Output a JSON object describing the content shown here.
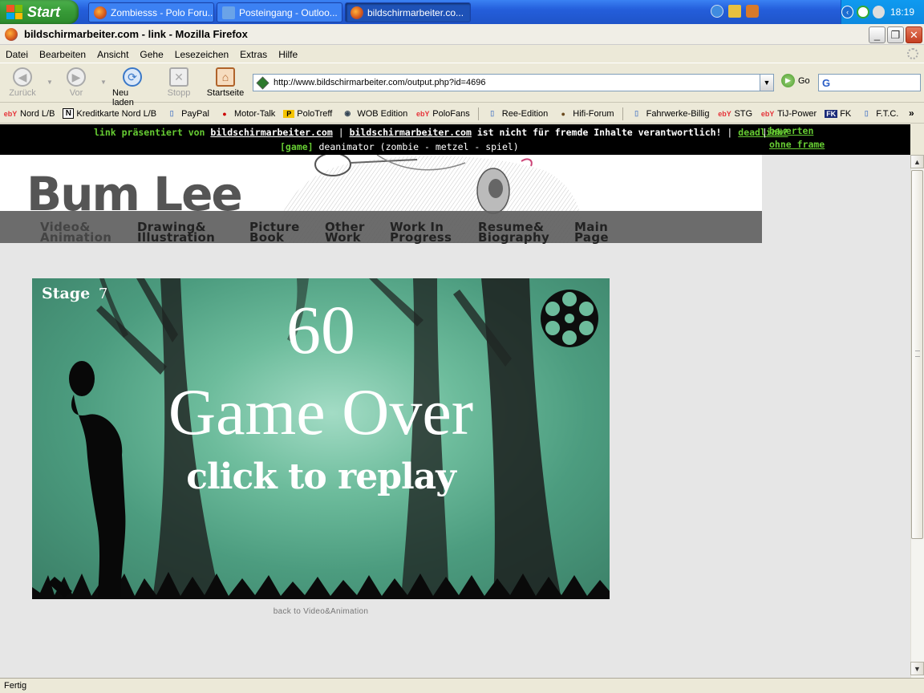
{
  "taskbar": {
    "start_label": "Start",
    "tasks": [
      {
        "label": "Zombiesss - Polo Foru..."
      },
      {
        "label": "Posteingang - Outloo..."
      },
      {
        "label": "bildschirmarbeiter.co..."
      }
    ],
    "clock": "18:19"
  },
  "window": {
    "title": "bildschirmarbeiter.com - link - Mozilla Firefox"
  },
  "menu": [
    "Datei",
    "Bearbeiten",
    "Ansicht",
    "Gehe",
    "Lesezeichen",
    "Extras",
    "Hilfe"
  ],
  "toolbar": {
    "back": "Zurück",
    "forward": "Vor",
    "reload": "Neu laden",
    "stop": "Stopp",
    "home": "Startseite",
    "url": "http://www.bildschirmarbeiter.com/output.php?id=4696",
    "go": "Go"
  },
  "bookmarks": [
    {
      "label": "Nord L/B",
      "icon": "ebay"
    },
    {
      "label": "Kreditkarte Nord L/B",
      "icon": "N"
    },
    {
      "label": "PayPal",
      "icon": "page"
    },
    {
      "label": "Motor-Talk",
      "icon": "mt"
    },
    {
      "label": "PoloTreff",
      "icon": "P"
    },
    {
      "label": "WOB Edition",
      "icon": "vw"
    },
    {
      "label": "PoloFans",
      "icon": "ebay"
    },
    {
      "label": "Ree-Edition",
      "icon": "page"
    },
    {
      "label": "Hifi-Forum",
      "icon": "globe"
    },
    {
      "label": "Fahrwerke-Billig",
      "icon": "page"
    },
    {
      "label": "STG",
      "icon": "ebay"
    },
    {
      "label": "TiJ-Power",
      "icon": "ebay"
    },
    {
      "label": "FK",
      "icon": "fk"
    },
    {
      "label": "F.T.C.",
      "icon": "page"
    }
  ],
  "infobar": {
    "presented_by": "link präsentiert von",
    "site": "bildschirmarbeiter.com",
    "sep1": "|",
    "site2": "bildschirmarbeiter.com",
    "disclaimer": "ist nicht für fremde Inhalte verantwortlich!",
    "sep2": "|",
    "deadlink": "deadlink?",
    "sep3": "|",
    "bewerten": "bewerten",
    "ohne_frame": "ohne frame",
    "tag": "[game]",
    "description": "deanimator (zombie - metzel - spiel)"
  },
  "site": {
    "logo": "Bum Lee",
    "nav": [
      {
        "line1": "Video&",
        "line2": "Animation"
      },
      {
        "line1": "Drawing&",
        "line2": "Illustration"
      },
      {
        "line1": "Picture",
        "line2": "Book"
      },
      {
        "line1": "Other",
        "line2": "Work"
      },
      {
        "line1": "Work In",
        "line2": "Progress"
      },
      {
        "line1": "Resume&",
        "line2": "Biography"
      },
      {
        "line1": "Main",
        "line2": "Page"
      }
    ],
    "back_link": "back to Video&Animation"
  },
  "game": {
    "stage_label": "Stage",
    "stage_number": "7",
    "score": "60",
    "game_over": "Game Over",
    "replay": "click to replay"
  },
  "status": "Fertig",
  "colors": {
    "accent_green": "#66cc33",
    "game_bg": "#4c9c7f"
  }
}
